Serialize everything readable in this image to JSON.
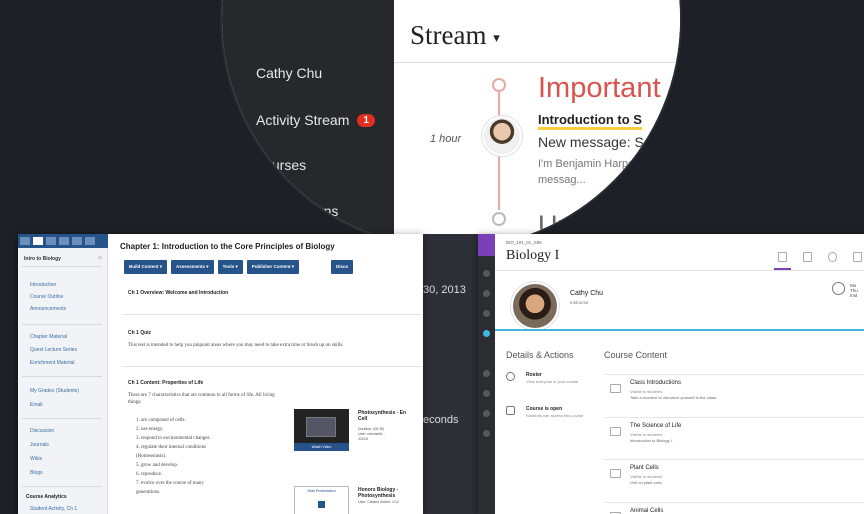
{
  "stream_view": {
    "sidebar": {
      "user_name": "Cathy Chu",
      "items": [
        {
          "label": "Activity Stream",
          "badge": "1"
        },
        {
          "label": "Courses"
        },
        {
          "label": "Organizations"
        }
      ]
    },
    "title": "Stream",
    "sections": {
      "important": "Important",
      "upcoming": "Upcoming"
    },
    "entry": {
      "time": "1 hour",
      "course": "Introduction to S",
      "subject": "New message: Se",
      "body_line1": "I'm Benjamin Harper,",
      "body_line2": "messag..."
    },
    "date_fragment": "30, 2013",
    "seconds_fragment": "econds"
  },
  "course_view": {
    "sidebar": {
      "course": "Intro to Biology",
      "links": [
        "Introduction",
        "Course Outline",
        "Announcements",
        "Chapter Material",
        "Quest Lecture Series",
        "Enrichment Material",
        "My Grades (Students)",
        "Email",
        "Discussion",
        "Journals",
        "Wikis",
        "Blogs",
        "Course Analytics",
        "Student Activity, Ch 1"
      ]
    },
    "title": "Chapter 1: Introduction to the Core Principles of Biology",
    "toolbar": [
      "Build Content",
      "Assessments",
      "Tools",
      "Publisher Content",
      "Disco"
    ],
    "sections": [
      {
        "heading": "Ch 1 Overview: Welcome and Introduction"
      },
      {
        "heading": "Ch 1 Quiz",
        "text": "This test is intended to help you pinpoint areas where you may need to take extra time or brush up on skills."
      },
      {
        "heading": "Ch 1 Content: Properties of Life",
        "text": "There are 7 characteristics that are common to all forms of life. All living things:"
      }
    ],
    "list": [
      "1. are composed of cells.",
      "2. use energy.",
      "3. respond to environmental changes.",
      "4. regulate their internal conditions",
      "   (Homeostasis).",
      "5. grow and develop.",
      "6. reproduce.",
      "7. evolve over the course of many",
      "   generations."
    ],
    "media": [
      {
        "title_line1": "Photosynthesis - En",
        "title_line2": "Cell",
        "meta_line1": "Duration: (00:35)",
        "meta_line2": "User: mbiolabbi…",
        "meta_line3": "32018",
        "thumb_label": "Watch Video"
      },
      {
        "title_line1": "Honors Biology -",
        "title_line2": "Photosynthesis",
        "meta": "User: Cleland  Added: 1/12",
        "thumb_label": "Slide Presentation"
      }
    ]
  },
  "biology_view": {
    "course_code": "BIO_101_01_S86",
    "title": "Biology I",
    "instructor": {
      "name": "Cathy Chu",
      "role": "Instructor"
    },
    "clock_text_line1": "Mo",
    "clock_text_line2": "Thu",
    "clock_text_line3": "Inst",
    "details_heading": "Details & Actions",
    "details": [
      {
        "title": "Roster",
        "sub": "View everyone in your course"
      },
      {
        "title": "Course is open",
        "sub": "Students can access this course"
      }
    ],
    "content_heading": "Course Content",
    "content": [
      {
        "title": "Class Introductions",
        "visibility": "Visible to students",
        "desc": "Take a moment to introduce yourself to the class."
      },
      {
        "title": "The Science of Life",
        "visibility": "Visible to students",
        "desc": "Introduction to Biology I."
      },
      {
        "title": "Plant Cells",
        "visibility": "Visible to students",
        "desc": "Unit on plant cells."
      },
      {
        "title": "Animal Cells",
        "visibility": "",
        "desc": ""
      }
    ]
  },
  "colors": {
    "background": "#1d2026",
    "badge": "#e22e1f",
    "important": "#d9534f",
    "ultra_accent": "#7b3fb8",
    "classic_blue": "#27538b",
    "banner_cyan": "#41b6e6"
  }
}
